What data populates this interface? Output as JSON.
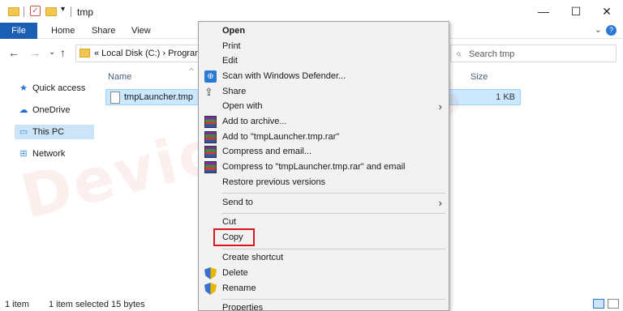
{
  "window": {
    "title": "tmp",
    "minimize": "—",
    "maximize": "☐",
    "close": "✕"
  },
  "ribbon": {
    "tabs": [
      "File",
      "Home",
      "Share",
      "View"
    ],
    "help": "?",
    "expand": "⌄"
  },
  "nav": {
    "back": "←",
    "forward": "→",
    "up_dropdown": "⌄",
    "up": "↑"
  },
  "address": {
    "text": "« Local Disk (C:) › Program"
  },
  "search": {
    "placeholder": "Search tmp"
  },
  "sidebar": {
    "items": [
      {
        "label": "Quick access"
      },
      {
        "label": "OneDrive"
      },
      {
        "label": "This PC"
      },
      {
        "label": "Network"
      }
    ]
  },
  "main": {
    "columns": {
      "name": "Name",
      "size": "Size"
    },
    "files": [
      {
        "name": "tmpLauncher.tmp",
        "size": "1 KB"
      }
    ]
  },
  "status": {
    "count": "1 item",
    "selection": "1 item selected  15 bytes"
  },
  "context_menu": {
    "open": "Open",
    "print": "Print",
    "edit": "Edit",
    "scan": "Scan with Windows Defender...",
    "share": "Share",
    "open_with": "Open with",
    "add_archive": "Add to archive...",
    "add_rar": "Add to \"tmpLauncher.tmp.rar\"",
    "compress_email": "Compress and email...",
    "compress_rar_email": "Compress to \"tmpLauncher.tmp.rar\" and email",
    "restore": "Restore previous versions",
    "send_to": "Send to",
    "cut": "Cut",
    "copy": "Copy",
    "create_shortcut": "Create shortcut",
    "delete": "Delete",
    "rename": "Rename",
    "properties": "Properties"
  },
  "watermark": "DeviceTricks",
  "colors": {
    "accent": "#1a5fb4",
    "selection": "#cce8ff",
    "highlight_box": "#d9161d"
  }
}
